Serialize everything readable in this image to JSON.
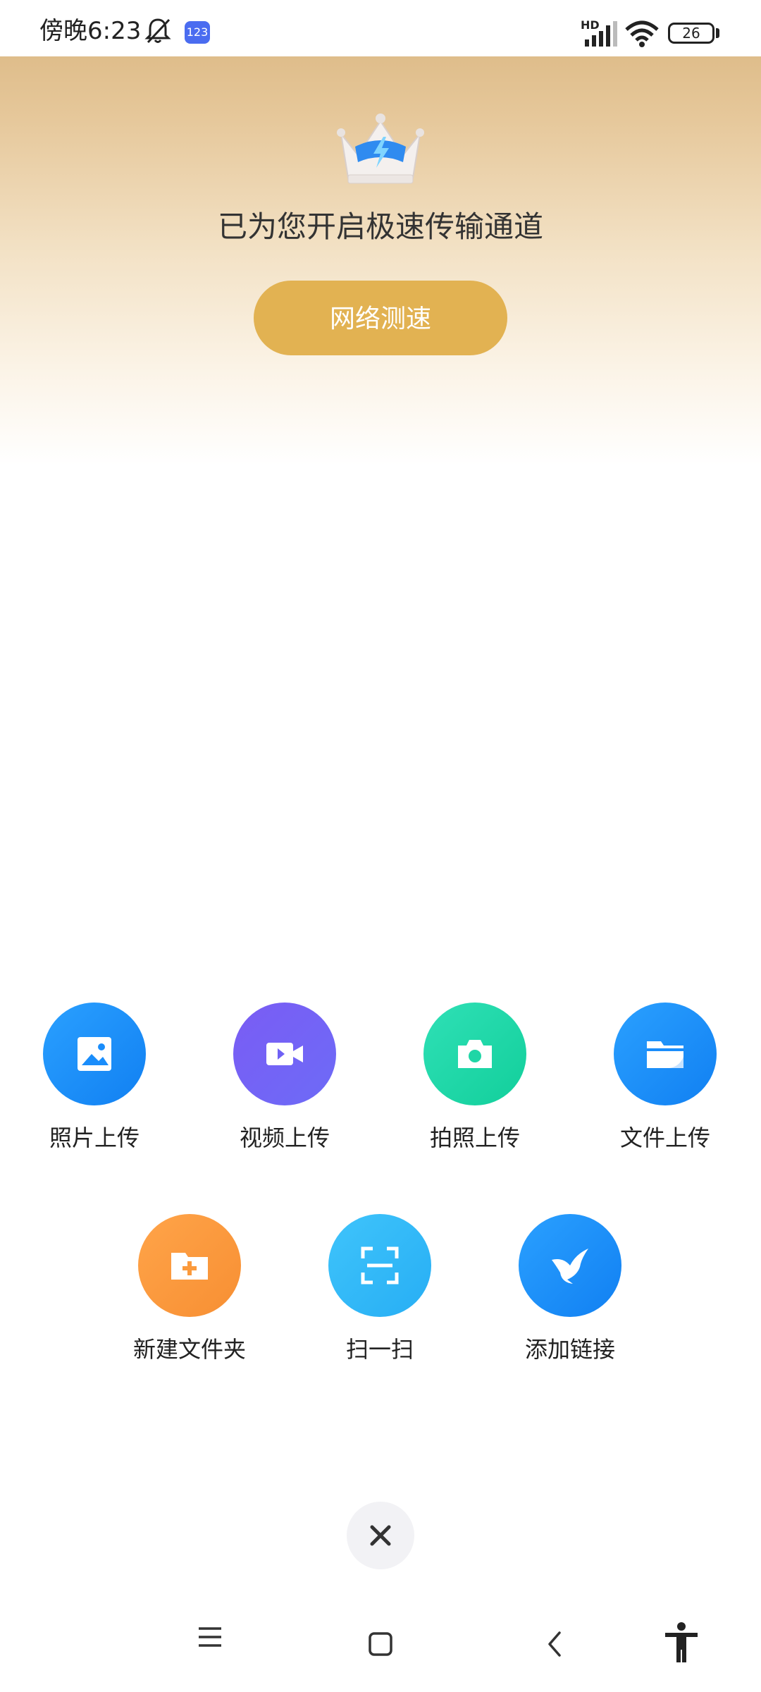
{
  "status_bar": {
    "time": "傍晚6:23",
    "app_badge": "123",
    "network_label": "HD",
    "battery_level": "26"
  },
  "hero": {
    "title": "已为您开启极速传输通道",
    "speed_test_label": "网络测速"
  },
  "actions": [
    {
      "label": "照片上传",
      "icon": "photo-icon",
      "color": "#1a8dfb"
    },
    {
      "label": "视频上传",
      "icon": "video-icon",
      "color": "#6f61f5"
    },
    {
      "label": "拍照上传",
      "icon": "camera-icon",
      "color": "#1fd6a6"
    },
    {
      "label": "文件上传",
      "icon": "folder-icon",
      "color": "#1a8dfb"
    },
    {
      "label": "新建文件夹",
      "icon": "new-folder-icon",
      "color": "#fb9a3c"
    },
    {
      "label": "扫一扫",
      "icon": "scan-icon",
      "color": "#33b8f6"
    },
    {
      "label": "添加链接",
      "icon": "bird-link-icon",
      "color": "#1a8dfb"
    }
  ],
  "nav": {
    "items": [
      "menu-icon",
      "home-icon",
      "back-icon",
      "accessibility-icon"
    ]
  }
}
